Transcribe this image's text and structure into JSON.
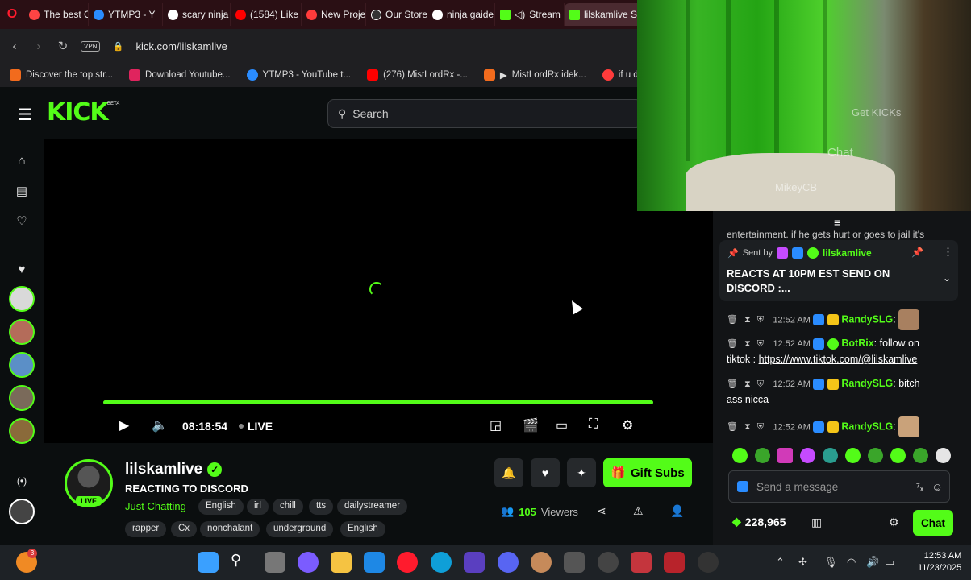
{
  "browser": {
    "tabs": [
      {
        "label": "The best C",
        "color": "#ff4444"
      },
      {
        "label": "YTMP3 - Y",
        "color": "#2a8cff"
      },
      {
        "label": "scary ninja",
        "color": "#4285f4"
      },
      {
        "label": "(1584) Like",
        "color": "#ff0000"
      },
      {
        "label": "New Proje",
        "color": "#ff3b3b"
      },
      {
        "label": "Our Stores",
        "color": "#ffffff"
      },
      {
        "label": "ninja gaide",
        "color": "#4285f4"
      },
      {
        "label": "Stream",
        "color": "#53fc18"
      },
      {
        "label": "lilskamlive Stream",
        "color": "#53fc18"
      }
    ],
    "url": "kick.com/lilskamlive",
    "vpn_label": "VPN",
    "bookmarks": [
      {
        "label": "Discover the top str...",
        "color": "#f26b1d"
      },
      {
        "label": "Download Youtube...",
        "color": "#e0245e"
      },
      {
        "label": "YTMP3 - YouTube t...",
        "color": "#2a8cff"
      },
      {
        "label": "(276) MistLordRx -...",
        "color": "#ff0000"
      },
      {
        "label": "MistLordRx idek...",
        "color": "#f26b1d"
      },
      {
        "label": "if u dont like it you b...",
        "color": "#ff3b3b"
      }
    ]
  },
  "kick": {
    "logo": "KICK",
    "beta": "BETA",
    "search_placeholder": "Search"
  },
  "player": {
    "time": "08:18:54",
    "live_label": "LIVE",
    "progress": 1.0
  },
  "channel": {
    "name": "lilskamlive",
    "live_badge": "LIVE",
    "title": "REACTING TO DISCORD",
    "category": "Just Chatting",
    "tags": [
      "English",
      "irl",
      "chill",
      "tts",
      "dailystreamer",
      "rapper",
      "Cx",
      "nonchalant",
      "underground",
      "English"
    ],
    "gift_label": "Gift Subs",
    "viewers_count": "105",
    "viewers_label": "Viewers"
  },
  "webcam": {
    "text_chat": "Chat",
    "text_kicks": "Get KICKs",
    "text_user": "MikeyCB"
  },
  "chat": {
    "top_line": "entertainment. if he gets hurt or goes to jail it's",
    "pinned": {
      "sent_by": "Sent by",
      "user": "lilskamlive",
      "message": "REACTS AT 10PM EST SEND ON DISCORD :..."
    },
    "messages": [
      {
        "time": "12:52 AM",
        "user": "RandySLG",
        "text": ""
      },
      {
        "time": "12:52 AM",
        "user": "BotRix",
        "text": "follow on",
        "text2": "tiktok : ",
        "link": "https://www.tiktok.com/@lilskamlive"
      },
      {
        "time": "12:52 AM",
        "user": "RandySLG",
        "text": "bitch",
        "text2": "ass nicca"
      },
      {
        "time": "12:52 AM",
        "user": "RandySLG",
        "text": ""
      }
    ],
    "input_placeholder": "Send a message",
    "points": "228,965",
    "send_label": "Chat"
  },
  "taskbar": {
    "time": "12:53 AM",
    "date": "11/23/2025",
    "notification_count": "3"
  }
}
